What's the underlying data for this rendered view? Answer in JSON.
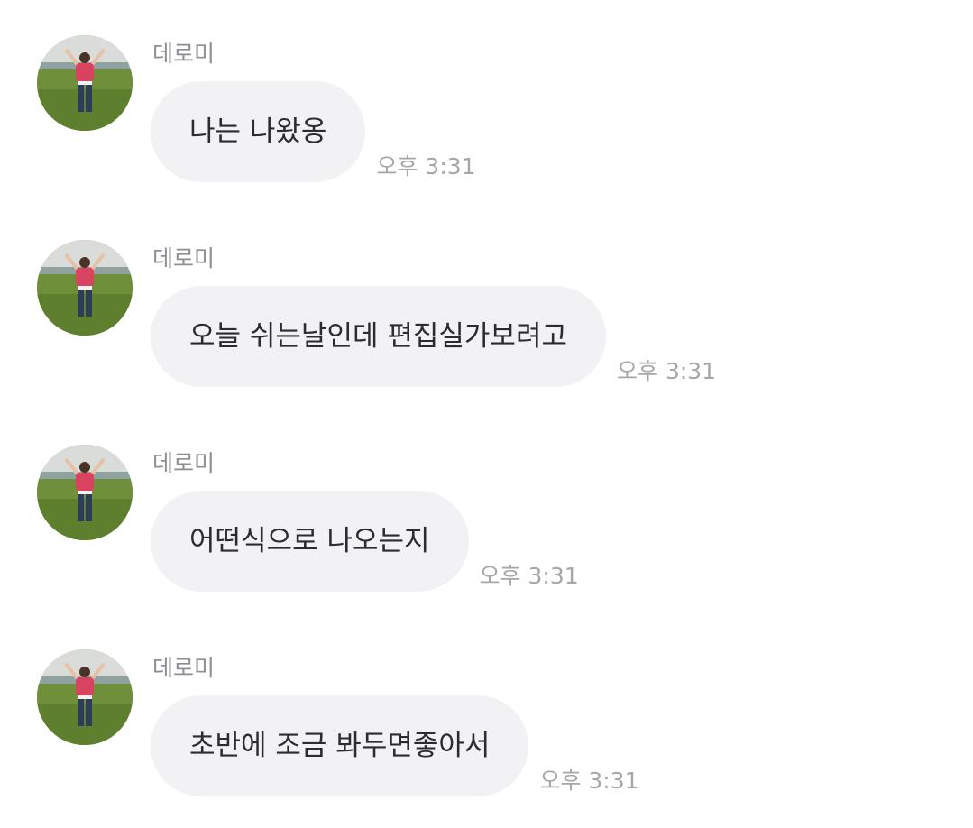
{
  "messages": [
    {
      "sender": "데로미",
      "text": "나는 나왔옹",
      "time": "오후 3:31"
    },
    {
      "sender": "데로미",
      "text": "오늘 쉬는날인데 편집실가보려고",
      "time": "오후 3:31"
    },
    {
      "sender": "데로미",
      "text": "어떤식으로 나오는지",
      "time": "오후 3:31"
    },
    {
      "sender": "데로미",
      "text": "초반에 조금 봐두면좋아서",
      "time": "오후 3:31"
    }
  ],
  "colors": {
    "bubble": "#f2f2f4",
    "message_text": "#2b2b30",
    "sender_text": "#8e8e93",
    "time_text": "#a6a6ab",
    "avatar_field": "#6f8f3a",
    "avatar_shirt": "#d9435f"
  },
  "icons": {
    "avatar": "profile-photo-person-in-field"
  }
}
